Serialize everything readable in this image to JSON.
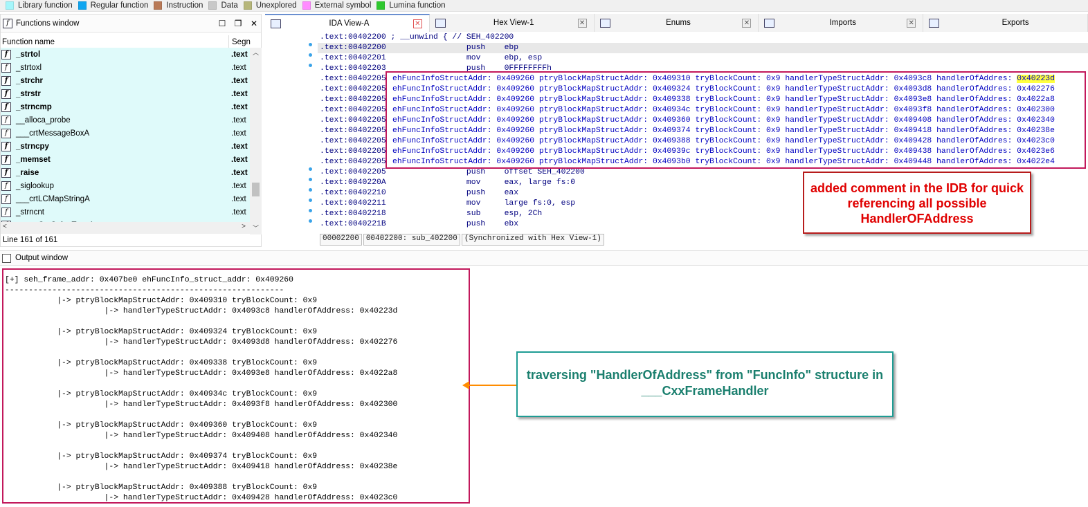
{
  "legend": [
    {
      "label": "Library function",
      "color": "#a6f6fb"
    },
    {
      "label": "Regular function",
      "color": "#0ea5f0"
    },
    {
      "label": "Instruction",
      "color": "#b97a57"
    },
    {
      "label": "Data",
      "color": "#c8c8c8"
    },
    {
      "label": "Unexplored",
      "color": "#b6b67a"
    },
    {
      "label": "External symbol",
      "color": "#ff8cff"
    },
    {
      "label": "Lumina function",
      "color": "#2ec82e"
    }
  ],
  "functions_window": {
    "title": "Functions window",
    "col_name": "Function name",
    "col_seg": "Segn",
    "rows": [
      {
        "name": "_strtol",
        "seg": ".text",
        "bold": true
      },
      {
        "name": "_strtoxl",
        "seg": ".text",
        "bold": false
      },
      {
        "name": "_strchr",
        "seg": ".text",
        "bold": true
      },
      {
        "name": "_strstr",
        "seg": ".text",
        "bold": true
      },
      {
        "name": "_strncmp",
        "seg": ".text",
        "bold": true
      },
      {
        "name": "__alloca_probe",
        "seg": ".text",
        "bold": false
      },
      {
        "name": "___crtMessageBoxA",
        "seg": ".text",
        "bold": false
      },
      {
        "name": "_strncpy",
        "seg": ".text",
        "bold": true
      },
      {
        "name": "_memset",
        "seg": ".text",
        "bold": true
      },
      {
        "name": "_raise",
        "seg": ".text",
        "bold": true
      },
      {
        "name": "_siglookup",
        "seg": ".text",
        "bold": false
      },
      {
        "name": "___crtLCMapStringA",
        "seg": ".text",
        "bold": false
      },
      {
        "name": "_strncnt",
        "seg": ".text",
        "bold": false
      },
      {
        "name": "___crtGetStringTypeA",
        "seg": ".text",
        "bold": false
      }
    ],
    "status": "Line 161 of 161"
  },
  "tabs": [
    {
      "label": "IDA View-A",
      "active": true
    },
    {
      "label": "Hex View-1",
      "active": false
    },
    {
      "label": "Enums",
      "active": false
    },
    {
      "label": "Imports",
      "active": false
    },
    {
      "label": "Exports",
      "active": false
    }
  ],
  "ida_lines": [
    ".text:00402200 ; __unwind { // SEH_402200",
    ".text:00402200                 push    ebp",
    ".text:00402201                 mov     ebp, esp",
    ".text:00402203                 push    0FFFFFFFFh",
    ".text:00402205",
    ".text:00402205",
    ".text:00402205",
    ".text:00402205",
    ".text:00402205",
    ".text:00402205",
    ".text:00402205",
    ".text:00402205",
    ".text:00402205",
    ".text:00402205                 push    offset SEH_402200",
    ".text:0040220A                 mov     eax, large fs:0",
    ".text:00402210                 push    eax",
    ".text:00402211                 mov     large fs:0, esp",
    ".text:00402218                 sub     esp, 2Ch",
    ".text:0040221B                 push    ebx"
  ],
  "comment_lines": [
    {
      "text": "ehFuncInfoStructAddr: 0x409260 ptryBlockMapStructAddr: 0x409310 tryBlockCount: 0x9 handlerTypeStructAddr: 0x4093c8 handlerOfAddres: ",
      "tail": "0x40223d"
    },
    {
      "text": "ehFuncInfoStructAddr: 0x409260 ptryBlockMapStructAddr: 0x409324 tryBlockCount: 0x9 handlerTypeStructAddr: 0x4093d8 handlerOfAddres: ",
      "tail": "0x402276"
    },
    {
      "text": "ehFuncInfoStructAddr: 0x409260 ptryBlockMapStructAddr: 0x409338 tryBlockCount: 0x9 handlerTypeStructAddr: 0x4093e8 handlerOfAddres: ",
      "tail": "0x4022a8"
    },
    {
      "text": "ehFuncInfoStructAddr: 0x409260 ptryBlockMapStructAddr: 0x40934c tryBlockCount: 0x9 handlerTypeStructAddr: 0x4093f8 handlerOfAddres: ",
      "tail": "0x402300"
    },
    {
      "text": "ehFuncInfoStructAddr: 0x409260 ptryBlockMapStructAddr: 0x409360 tryBlockCount: 0x9 handlerTypeStructAddr: 0x409408 handlerOfAddres: ",
      "tail": "0x402340"
    },
    {
      "text": "ehFuncInfoStructAddr: 0x409260 ptryBlockMapStructAddr: 0x409374 tryBlockCount: 0x9 handlerTypeStructAddr: 0x409418 handlerOfAddres: ",
      "tail": "0x40238e"
    },
    {
      "text": "ehFuncInfoStructAddr: 0x409260 ptryBlockMapStructAddr: 0x409388 tryBlockCount: 0x9 handlerTypeStructAddr: 0x409428 handlerOfAddres: ",
      "tail": "0x4023c0"
    },
    {
      "text": "ehFuncInfoStructAddr: 0x409260 ptryBlockMapStructAddr: 0x40939c tryBlockCount: 0x9 handlerTypeStructAddr: 0x409438 handlerOfAddres: ",
      "tail": "0x4023e6"
    },
    {
      "text": "ehFuncInfoStructAddr: 0x409260 ptryBlockMapStructAddr: 0x4093b0 tryBlockCount: 0x9 handlerTypeStructAddr: 0x409448 handlerOfAddres: ",
      "tail": "0x4022e4"
    }
  ],
  "ida_status": [
    "00002200",
    "00402200: sub_402200",
    "(Synchronized with Hex View-1)"
  ],
  "annotation_idb": "added comment in the IDB for quick referencing all possible HandlerOFAddress",
  "output_title": "Output window",
  "output_lines": [
    "[+] seh_frame_addr: 0x407be0 ehFuncInfo_struct_addr: 0x409260",
    "-----------------------------------------------------------",
    "           |-> ptryBlockMapStructAddr: 0x409310 tryBlockCount: 0x9",
    "                     |-> handlerTypeStructAddr: 0x4093c8 handlerOfAddress: 0x40223d",
    "",
    "           |-> ptryBlockMapStructAddr: 0x409324 tryBlockCount: 0x9",
    "                     |-> handlerTypeStructAddr: 0x4093d8 handlerOfAddress: 0x402276",
    "",
    "           |-> ptryBlockMapStructAddr: 0x409338 tryBlockCount: 0x9",
    "                     |-> handlerTypeStructAddr: 0x4093e8 handlerOfAddress: 0x4022a8",
    "",
    "           |-> ptryBlockMapStructAddr: 0x40934c tryBlockCount: 0x9",
    "                     |-> handlerTypeStructAddr: 0x4093f8 handlerOfAddress: 0x402300",
    "",
    "           |-> ptryBlockMapStructAddr: 0x409360 tryBlockCount: 0x9",
    "                     |-> handlerTypeStructAddr: 0x409408 handlerOfAddress: 0x402340",
    "",
    "           |-> ptryBlockMapStructAddr: 0x409374 tryBlockCount: 0x9",
    "                     |-> handlerTypeStructAddr: 0x409418 handlerOfAddress: 0x40238e",
    "",
    "           |-> ptryBlockMapStructAddr: 0x409388 tryBlockCount: 0x9",
    "                     |-> handlerTypeStructAddr: 0x409428 handlerOfAddress: 0x4023c0"
  ],
  "annotation_traverse": "traversing \"HandlerOfAddress\" from \"FuncInfo\" structure in ___CxxFrameHandler"
}
